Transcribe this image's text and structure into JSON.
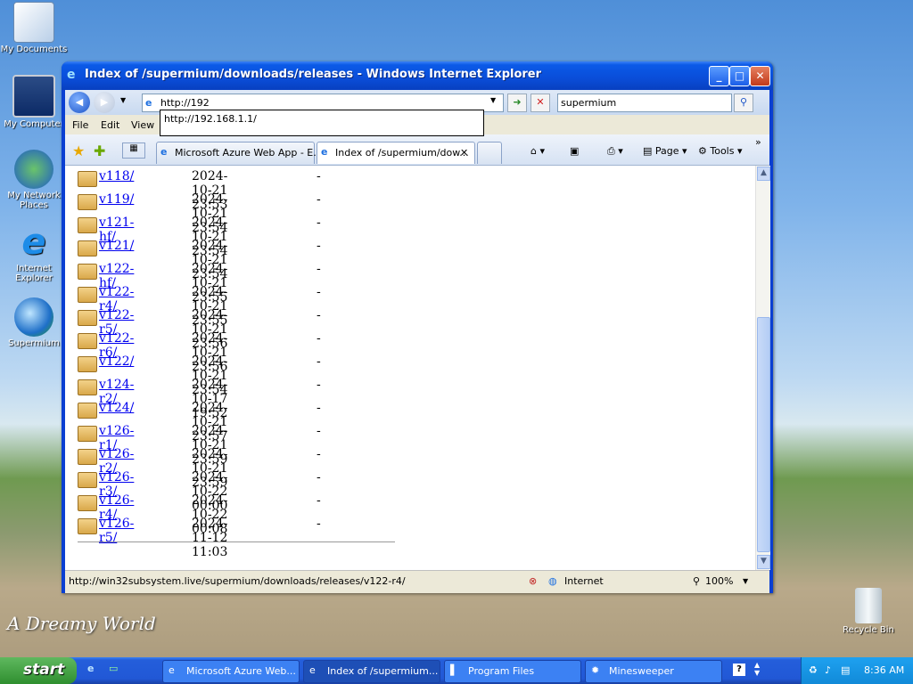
{
  "desktop": {
    "icons": [
      "My Documents",
      "My Computer",
      "My Network Places",
      "Internet Explorer",
      "Supermium",
      "Recycle Bin"
    ],
    "wallpaper_text": "A Dreamy World"
  },
  "window": {
    "title": "Index of /supermium/downloads/releases - Windows Internet Explorer",
    "address_value": "http://192",
    "address_suggestion": "http://192.168.1.1/",
    "search_value": "supermium",
    "menu": [
      "File",
      "Edit",
      "View"
    ],
    "tabs": [
      "Microsoft Azure Web App - E...",
      "Index of /supermium/dow..."
    ],
    "tools": {
      "page": "Page",
      "tools": "Tools"
    },
    "listing": [
      {
        "name": "v118/",
        "date": "2024-10-21 23:53",
        "size": "-"
      },
      {
        "name": "v119/",
        "date": "2024-10-21 23:54",
        "size": "-"
      },
      {
        "name": "v121-hf/",
        "date": "2024-10-21 23:54",
        "size": "-"
      },
      {
        "name": "v121/",
        "date": "2024-10-21 23:54",
        "size": "-"
      },
      {
        "name": "v122-hf/",
        "date": "2024-10-21 23:55",
        "size": "-"
      },
      {
        "name": "v122-r4/",
        "date": "2024-10-21 23:55",
        "size": "-"
      },
      {
        "name": "v122-r5/",
        "date": "2024-10-21 23:56",
        "size": "-"
      },
      {
        "name": "v122-r6/",
        "date": "2024-10-21 23:56",
        "size": "-"
      },
      {
        "name": "v122/",
        "date": "2024-10-21 23:54",
        "size": "-"
      },
      {
        "name": "v124-r2/",
        "date": "2024-10-17 19:52",
        "size": "-"
      },
      {
        "name": "v124/",
        "date": "2024-10-21 23:57",
        "size": "-"
      },
      {
        "name": "v126-r1/",
        "date": "2024-10-21 23:59",
        "size": "-"
      },
      {
        "name": "v126-r2/",
        "date": "2024-10-21 23:59",
        "size": "-"
      },
      {
        "name": "v126-r3/",
        "date": "2024-10-22 00:00",
        "size": "-"
      },
      {
        "name": "v126-r4/",
        "date": "2024-10-22 00:08",
        "size": "-"
      },
      {
        "name": "v126-r5/",
        "date": "2024-11-12 11:03",
        "size": "-"
      }
    ],
    "status_url": "http://win32subsystem.live/supermium/downloads/releases/v122-r4/",
    "status_zone": "Internet",
    "zoom": "100%"
  },
  "taskbar": {
    "start": "start",
    "tasks": [
      "Microsoft Azure Web...",
      "Index of /supermium...",
      "Program Files",
      "Minesweeper"
    ],
    "clock": "8:36 AM"
  },
  "colors": {
    "link": "#0000ee",
    "title_bar": "#0a4dd8",
    "taskbar": "#2158d6"
  }
}
